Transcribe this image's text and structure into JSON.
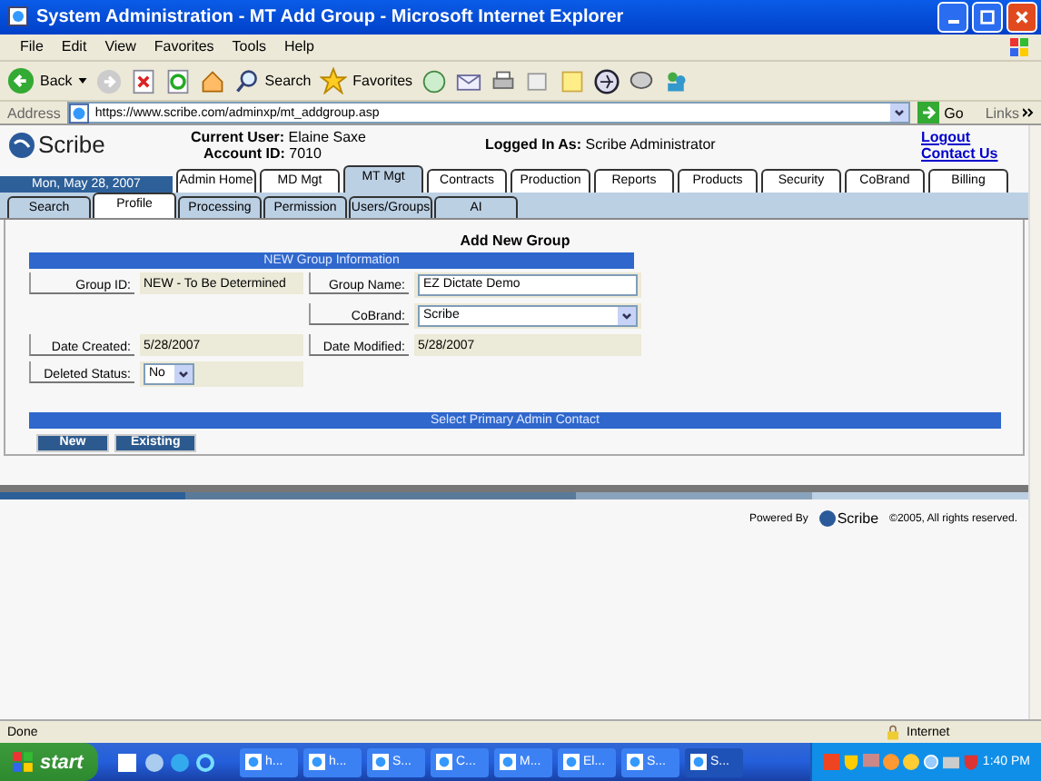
{
  "window": {
    "title": "System Administration - MT Add Group - Microsoft Internet Explorer"
  },
  "menu": [
    "File",
    "Edit",
    "View",
    "Favorites",
    "Tools",
    "Help"
  ],
  "toolbar": {
    "back": "Back",
    "search": "Search",
    "favorites": "Favorites"
  },
  "address": {
    "label": "Address",
    "url": "https://www.scribe.com/adminxp/mt_addgroup.asp",
    "go": "Go",
    "links": "Links"
  },
  "header": {
    "logo": "Scribe",
    "current_user_label": "Current User:",
    "current_user": "Elaine Saxe",
    "account_label": "Account ID:",
    "account": "7010",
    "logged_label": "Logged In As:",
    "logged": "Scribe Administrator",
    "links": [
      "Logout",
      "Contact Us"
    ]
  },
  "date": "Mon, May 28, 2007",
  "tabs": [
    {
      "label": "Admin Home",
      "selected": false
    },
    {
      "label": "MD Mgt",
      "selected": false
    },
    {
      "label": "MT Mgt",
      "selected": true
    },
    {
      "label": "Contracts",
      "selected": false
    },
    {
      "label": "Production",
      "selected": false
    },
    {
      "label": "Reports",
      "selected": false
    },
    {
      "label": "Products",
      "selected": false
    },
    {
      "label": "Security",
      "selected": false
    },
    {
      "label": "CoBrand",
      "selected": false
    },
    {
      "label": "Billing",
      "selected": false
    }
  ],
  "subtabs": [
    {
      "label": "Search",
      "selected": false
    },
    {
      "label": "Profile",
      "selected": true
    },
    {
      "label": "Processing",
      "selected": false
    },
    {
      "label": "Permission",
      "selected": false
    },
    {
      "label": "Users/Groups",
      "selected": false
    },
    {
      "label": "AI",
      "selected": false
    }
  ],
  "form": {
    "title": "Add New Group",
    "section": "NEW Group Information",
    "rows": [
      {
        "left": {
          "label": "Group ID:",
          "kind": "readonly",
          "value": "NEW - To Be Determined"
        },
        "right": {
          "label": "Group Name:",
          "kind": "input",
          "value": "EZ Dictate Demo"
        }
      },
      {
        "right": {
          "label": "CoBrand:",
          "kind": "select",
          "value": "Scribe"
        }
      },
      {
        "left": {
          "label": "Date Created:",
          "kind": "readonly",
          "value": "5/28/2007"
        },
        "right": {
          "label": "Date Modified:",
          "kind": "readonly",
          "value": "5/28/2007"
        }
      },
      {
        "left": {
          "label": "Deleted Status:",
          "kind": "select",
          "value": "No"
        }
      }
    ],
    "contact_section": "Select Primary Admin Contact",
    "buttons": [
      "New",
      "Existing"
    ]
  },
  "footer": {
    "powered": "Powered By",
    "logo": "Scribe",
    "copyright": "©2005, All rights reserved."
  },
  "status_bar": {
    "text": "Done",
    "zone": "Internet"
  },
  "taskbar": {
    "start": "start",
    "tasks": [
      {
        "label": "h...",
        "selected": false
      },
      {
        "label": "h...",
        "selected": false
      },
      {
        "label": "S...",
        "selected": false
      },
      {
        "label": "C...",
        "selected": false
      },
      {
        "label": "M...",
        "selected": false
      },
      {
        "label": "El...",
        "selected": false
      },
      {
        "label": "S...",
        "selected": false
      },
      {
        "label": "S...",
        "selected": true
      }
    ],
    "clock": "1:40 PM"
  }
}
